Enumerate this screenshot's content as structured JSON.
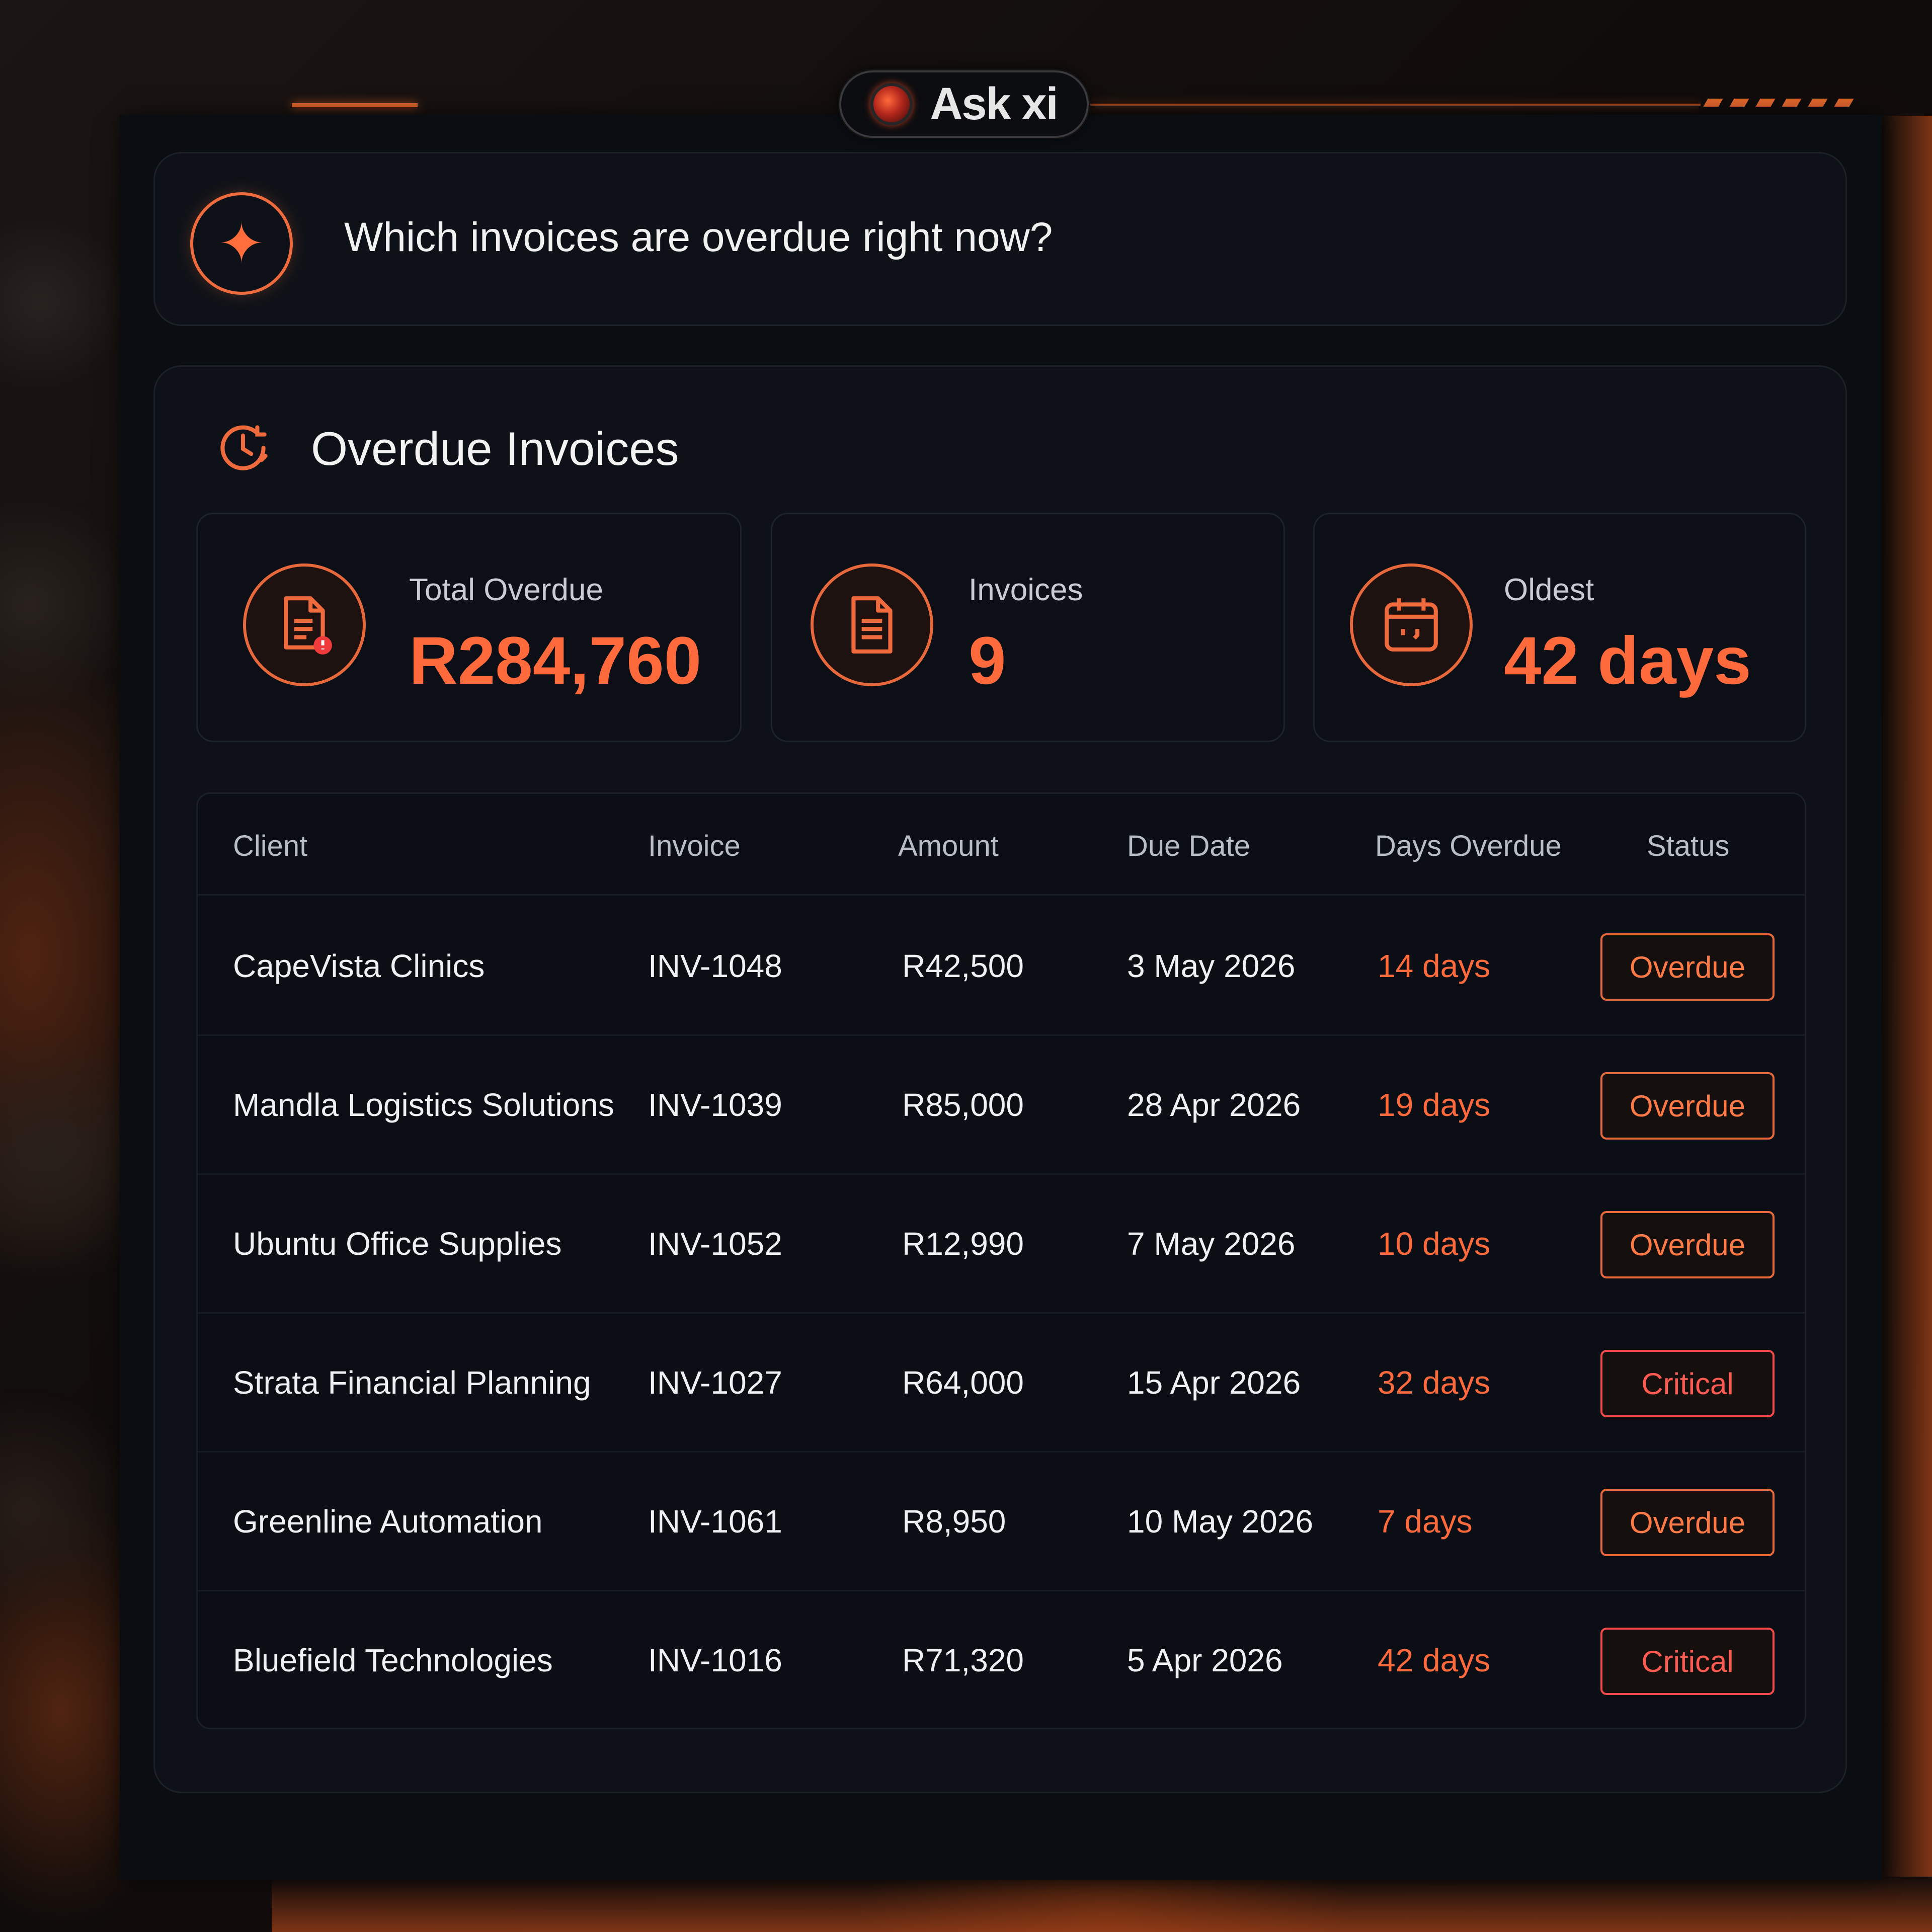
{
  "assistant": {
    "name": "Ask xi"
  },
  "query": {
    "text": "Which invoices are overdue right now?"
  },
  "section": {
    "title": "Overdue Invoices"
  },
  "stats": [
    {
      "label": "Total Overdue",
      "value": "R284,760",
      "icon": "invoice-alert-icon"
    },
    {
      "label": "Invoices",
      "value": "9",
      "icon": "document-icon"
    },
    {
      "label": "Oldest",
      "value": "42 days",
      "icon": "calendar-icon"
    }
  ],
  "table": {
    "headers": [
      "Client",
      "Invoice",
      "Amount",
      "Due Date",
      "Days Overdue",
      "Status"
    ],
    "rows": [
      {
        "client": "CapeVista Clinics",
        "invoice": "INV-1048",
        "amount": "R42,500",
        "due": "3 May 2026",
        "days": "14 days",
        "status": "Overdue"
      },
      {
        "client": "Mandla Logistics Solutions",
        "invoice": "INV-1039",
        "amount": "R85,000",
        "due": "28 Apr 2026",
        "days": "19 days",
        "status": "Overdue"
      },
      {
        "client": "Ubuntu Office Supplies",
        "invoice": "INV-1052",
        "amount": "R12,990",
        "due": "7 May 2026",
        "days": "10 days",
        "status": "Overdue"
      },
      {
        "client": "Strata Financial Planning",
        "invoice": "INV-1027",
        "amount": "R64,000",
        "due": "15 Apr 2026",
        "days": "32 days",
        "status": "Critical"
      },
      {
        "client": "Greenline Automation",
        "invoice": "INV-1061",
        "amount": "R8,950",
        "due": "10 May 2026",
        "days": "7 days",
        "status": "Overdue"
      },
      {
        "client": "Bluefield Technologies",
        "invoice": "INV-1016",
        "amount": "R71,320",
        "due": "5 Apr 2026",
        "days": "42 days",
        "status": "Critical"
      }
    ]
  },
  "colors": {
    "accent": "#ff6a3d",
    "critical": "#f24a4a",
    "panel": "#0a0e13"
  }
}
